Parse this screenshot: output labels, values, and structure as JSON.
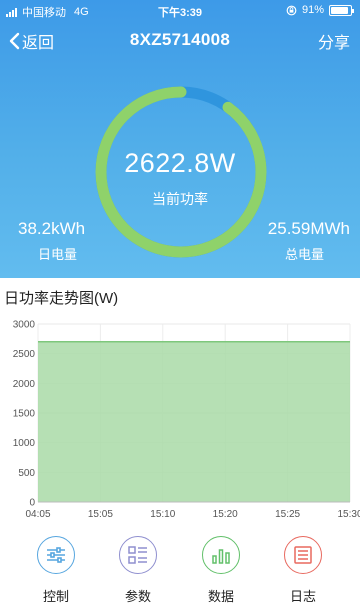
{
  "status_bar": {
    "carrier": "中国移动",
    "network": "4G",
    "time": "下午3:39",
    "battery": "91%",
    "battery_level": 0.91
  },
  "nav": {
    "back_label": "返回",
    "title": "8XZ5714008",
    "share_label": "分享"
  },
  "gauge": {
    "value": "2622.8W",
    "label": "当前功率",
    "fill_fraction": 0.9,
    "track_color": "#2f95de",
    "fill_color": "#8fd26a"
  },
  "stats": {
    "day_value": "38.2kWh",
    "day_label": "日电量",
    "total_value": "25.59MWh",
    "total_label": "总电量"
  },
  "chart_title": "日功率走势图(W)",
  "chart_data": {
    "type": "area",
    "x": [
      "04:05",
      "15:05",
      "15:10",
      "15:20",
      "15:25",
      "15:30"
    ],
    "series": [
      {
        "values": [
          2700,
          2700,
          2700,
          2700,
          2700,
          2700
        ],
        "color": "#a9dba7"
      }
    ],
    "ylim": [
      0,
      3000
    ],
    "yticks": [
      0,
      500,
      1000,
      1500,
      2000,
      2500,
      3000
    ],
    "grid": true
  },
  "tabs": [
    {
      "label": "控制",
      "icon": "sliders-icon",
      "color": "#57a6df"
    },
    {
      "label": "参数",
      "icon": "list-icon",
      "color": "#8f8fcf"
    },
    {
      "label": "数据",
      "icon": "bar-chart-icon",
      "color": "#62c06a"
    },
    {
      "label": "日志",
      "icon": "log-icon",
      "color": "#e8695f"
    }
  ]
}
